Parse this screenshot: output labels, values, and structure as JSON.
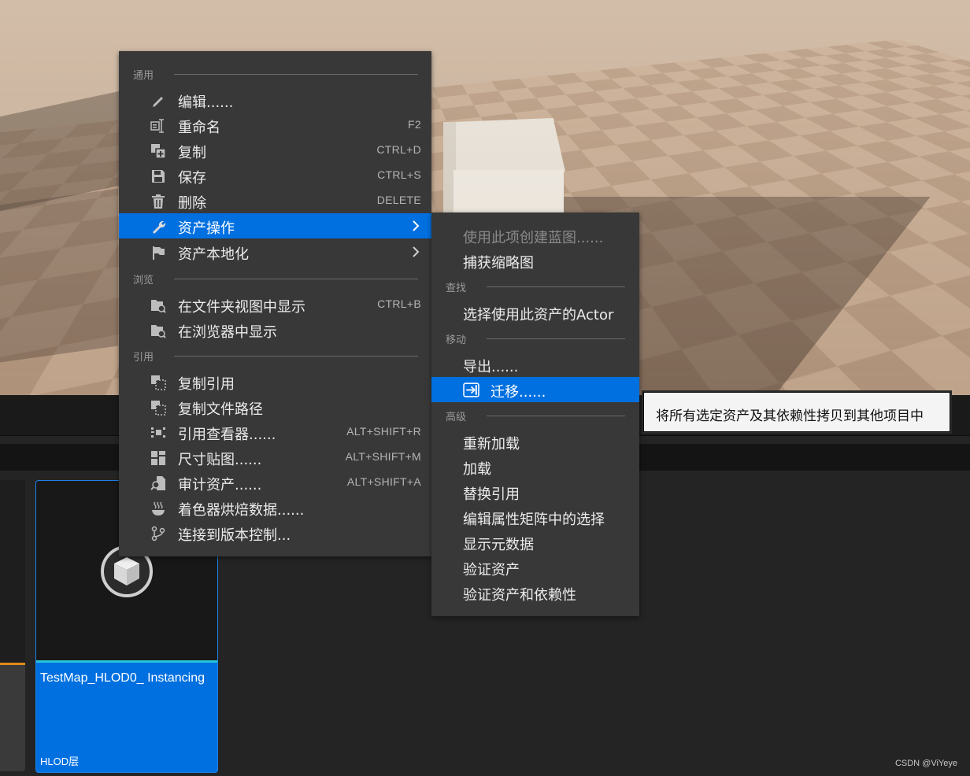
{
  "main_menu": {
    "sections": {
      "general": "通用",
      "browse": "浏览",
      "reference": "引用"
    },
    "items": [
      {
        "label": "编辑......",
        "shortcut": ""
      },
      {
        "label": "重命名",
        "shortcut": "F2"
      },
      {
        "label": "复制",
        "shortcut": "CTRL+D"
      },
      {
        "label": "保存",
        "shortcut": "CTRL+S"
      },
      {
        "label": "删除",
        "shortcut": "DELETE"
      },
      {
        "label": "资产操作",
        "shortcut": ""
      },
      {
        "label": "资产本地化",
        "shortcut": ""
      },
      {
        "label": "在文件夹视图中显示",
        "shortcut": "CTRL+B"
      },
      {
        "label": "在浏览器中显示",
        "shortcut": ""
      },
      {
        "label": "复制引用",
        "shortcut": ""
      },
      {
        "label": "复制文件路径",
        "shortcut": ""
      },
      {
        "label": "引用查看器......",
        "shortcut": "ALT+SHIFT+R"
      },
      {
        "label": "尺寸贴图......",
        "shortcut": "ALT+SHIFT+M"
      },
      {
        "label": "审计资产......",
        "shortcut": "ALT+SHIFT+A"
      },
      {
        "label": "着色器烘焙数据......",
        "shortcut": ""
      },
      {
        "label": "连接到版本控制...",
        "shortcut": ""
      }
    ]
  },
  "sub_menu": {
    "sections": {
      "find": "查找",
      "move": "移动",
      "advanced": "高级"
    },
    "items": [
      {
        "label": "使用此项创建蓝图......"
      },
      {
        "label": "捕获缩略图"
      },
      {
        "label": "选择使用此资产的Actor"
      },
      {
        "label": "导出......"
      },
      {
        "label": "迁移......"
      },
      {
        "label": "重新加载"
      },
      {
        "label": "加载"
      },
      {
        "label": "替换引用"
      },
      {
        "label": "编辑属性矩阵中的选择"
      },
      {
        "label": "显示元数据"
      },
      {
        "label": "验证资产"
      },
      {
        "label": "验证资产和依赖性"
      }
    ]
  },
  "tooltip": {
    "text": "将所有选定资产及其依赖性拷贝到其他项目中"
  },
  "asset": {
    "name": "TestMap_HLOD0_ Instancing",
    "type": "HLOD层"
  },
  "watermark": "CSDN @ViYeye",
  "colors": {
    "menu_bg": "#383838",
    "highlight": "#0070e0",
    "tooltip_bg": "#f4f4f4"
  }
}
